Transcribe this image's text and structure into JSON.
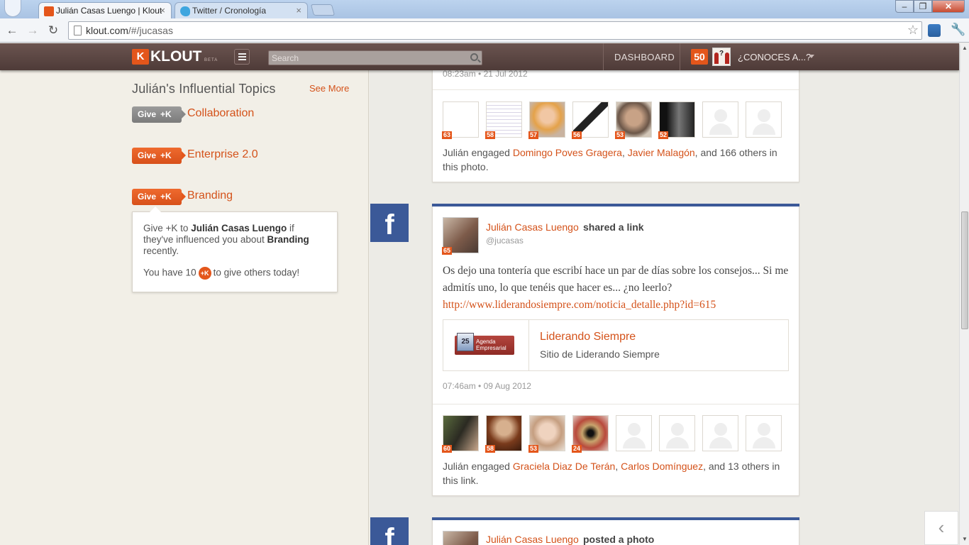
{
  "browser": {
    "tabs": [
      {
        "title": "Julián Casas Luengo | Klout",
        "active": true
      },
      {
        "title": "Twitter / Cronología",
        "active": false
      }
    ],
    "url_host": "klout.com",
    "url_path": "/#/jucasas"
  },
  "header": {
    "logo_text": "KLOUT",
    "beta_label": "BETA",
    "search_placeholder": "Search",
    "dashboard_label": "DASHBOARD",
    "score": "50",
    "user_menu_label": "¿CONOCES A...?"
  },
  "sidebar": {
    "topics_title": "Julián's Influential Topics",
    "see_more": "See More",
    "give_label": "Give",
    "plusk_label": "+K",
    "topics": [
      {
        "label": "Collaboration",
        "state": "inactive"
      },
      {
        "label": "Enterprise 2.0",
        "state": "active"
      },
      {
        "label": "Branding",
        "state": "active"
      }
    ],
    "tooltip": {
      "line1_prefix": "Give +K to",
      "line1_name": "Julián Casas Luengo",
      "line1_mid": "if they've influenced you about",
      "line1_topic": "Branding",
      "line1_suffix": "recently.",
      "line2_prefix": "You have 10",
      "coin_label": "+K",
      "line2_suffix": "to give others today!"
    }
  },
  "feed": {
    "card1": {
      "timestamp": "08:23am • 21 Jul 2012",
      "avatar_scores": [
        "63",
        "58",
        "57",
        "56",
        "53",
        "52",
        "",
        ""
      ],
      "engaged_prefix": "Julián engaged",
      "engaged_name1": "Domingo Poves Gragera",
      "engaged_name2": "Javier Malagón",
      "engaged_suffix": ", and 166 others in this photo."
    },
    "card2": {
      "network_icon": "f",
      "author_score": "65",
      "author": "Julián Casas Luengo",
      "action": "shared a link",
      "handle": "@jucasas",
      "body_text": "Os dejo una tontería que escribí hace un par de días sobre los consejos... Si me admitís uno, lo que tenéis que hacer es... ¿no leerlo?",
      "body_link": "http://www.liderandosiempre.com/noticia_detalle.php?id=615",
      "preview_logo_text": "Agenda Empresarial",
      "preview_title": "Liderando Siempre",
      "preview_desc": "Sitio de Liderando Siempre",
      "timestamp": "07:46am • 09 Aug 2012",
      "avatar_scores": [
        "60",
        "58",
        "53",
        "24",
        "",
        "",
        "",
        ""
      ],
      "engaged_prefix": "Julián engaged",
      "engaged_name1": "Graciela Diaz De Terán",
      "engaged_name2": "Carlos Domínguez",
      "engaged_suffix": ", and 13 others in this link."
    },
    "card3": {
      "network_icon": "f",
      "author": "Julián Casas Luengo",
      "action": "posted a photo"
    }
  },
  "colors": {
    "accent": "#e4561b",
    "link": "#d4521a",
    "facebook": "#3b5998",
    "header_bg": "#5c4643"
  }
}
